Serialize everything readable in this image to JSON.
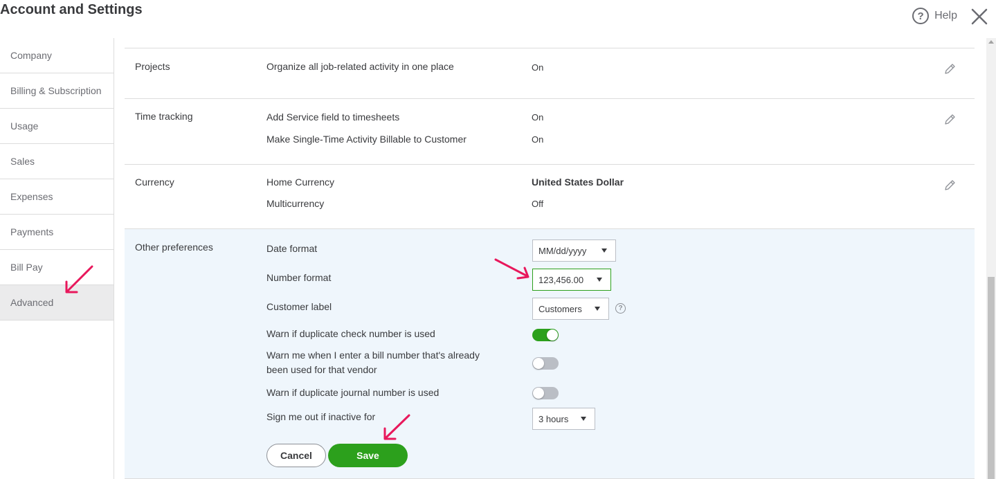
{
  "header": {
    "title": "Account and Settings",
    "help_label": "Help"
  },
  "sidebar": {
    "items": [
      {
        "label": "Company"
      },
      {
        "label": "Billing & Subscription"
      },
      {
        "label": "Usage"
      },
      {
        "label": "Sales"
      },
      {
        "label": "Expenses"
      },
      {
        "label": "Payments"
      },
      {
        "label": "Bill Pay"
      },
      {
        "label": "Advanced",
        "active": true
      }
    ]
  },
  "sections": {
    "projects": {
      "title": "Projects",
      "rows": [
        {
          "label": "Organize all job-related activity in one place",
          "value": "On"
        }
      ]
    },
    "time_tracking": {
      "title": "Time tracking",
      "rows": [
        {
          "label": "Add Service field to timesheets",
          "value": "On"
        },
        {
          "label": "Make Single-Time Activity Billable to Customer",
          "value": "On"
        }
      ]
    },
    "currency": {
      "title": "Currency",
      "rows": [
        {
          "label": "Home Currency",
          "value": "United States Dollar"
        },
        {
          "label": "Multicurrency",
          "value": "Off"
        }
      ]
    },
    "other": {
      "title": "Other preferences",
      "date_format": {
        "label": "Date format",
        "value": "MM/dd/yyyy"
      },
      "number_format": {
        "label": "Number format",
        "value": "123,456.00"
      },
      "customer_label": {
        "label": "Customer label",
        "value": "Customers",
        "help": "?"
      },
      "warn_check": {
        "label": "Warn if duplicate check number is used",
        "state": "on"
      },
      "warn_bill": {
        "label": "Warn me when I enter a bill number that's already been used for that vendor",
        "state": "off"
      },
      "warn_journal": {
        "label": "Warn if duplicate journal number is used",
        "state": "off"
      },
      "sign_out": {
        "label": "Sign me out if inactive for",
        "value": "3 hours"
      }
    }
  },
  "actions": {
    "cancel_label": "Cancel",
    "save_label": "Save"
  },
  "colors": {
    "accent": "#2ca01c",
    "annotation_arrow": "#e8185c",
    "other_bg": "#eff6fc"
  }
}
